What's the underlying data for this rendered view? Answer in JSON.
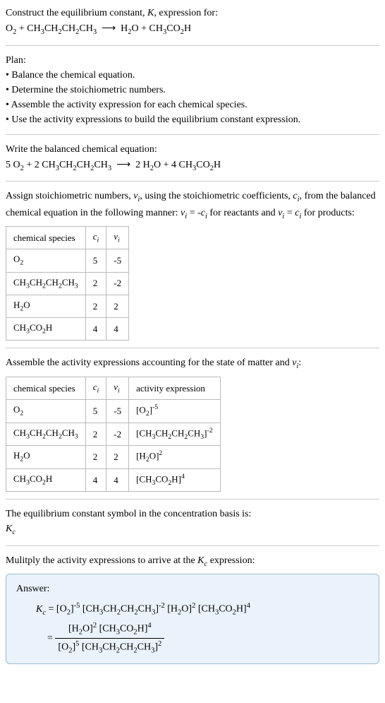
{
  "header": {
    "line1": "Construct the equilibrium constant, K, expression for:",
    "equation": "O₂ + CH₃CH₂CH₂CH₃  ⟶  H₂O + CH₃CO₂H"
  },
  "plan": {
    "title": "Plan:",
    "items": [
      "• Balance the chemical equation.",
      "• Determine the stoichiometric numbers.",
      "• Assemble the activity expression for each chemical species.",
      "• Use the activity expressions to build the equilibrium constant expression."
    ]
  },
  "balanced": {
    "title": "Write the balanced chemical equation:",
    "equation": "5 O₂ + 2 CH₃CH₂CH₂CH₃  ⟶  2 H₂O + 4 CH₃CO₂H"
  },
  "stoich": {
    "intro1": "Assign stoichiometric numbers, νᵢ, using the stoichiometric coefficients, cᵢ, from",
    "intro2": "the balanced chemical equation in the following manner: νᵢ = -cᵢ for reactants",
    "intro3": "and νᵢ = cᵢ for products:",
    "headers": [
      "chemical species",
      "cᵢ",
      "νᵢ"
    ],
    "rows": [
      {
        "species": "O₂",
        "c": "5",
        "v": "-5"
      },
      {
        "species": "CH₃CH₂CH₂CH₃",
        "c": "2",
        "v": "-2"
      },
      {
        "species": "H₂O",
        "c": "2",
        "v": "2"
      },
      {
        "species": "CH₃CO₂H",
        "c": "4",
        "v": "4"
      }
    ]
  },
  "activity": {
    "intro": "Assemble the activity expressions accounting for the state of matter and νᵢ:",
    "headers": [
      "chemical species",
      "cᵢ",
      "νᵢ",
      "activity expression"
    ],
    "rows": [
      {
        "species": "O₂",
        "c": "5",
        "v": "-5",
        "expr": "[O₂]⁻⁵"
      },
      {
        "species": "CH₃CH₂CH₂CH₃",
        "c": "2",
        "v": "-2",
        "expr": "[CH₃CH₂CH₂CH₃]⁻²"
      },
      {
        "species": "H₂O",
        "c": "2",
        "v": "2",
        "expr": "[H₂O]²"
      },
      {
        "species": "CH₃CO₂H",
        "c": "4",
        "v": "4",
        "expr": "[CH₃CO₂H]⁴"
      }
    ]
  },
  "kc_symbol": {
    "line1": "The equilibrium constant symbol in the concentration basis is:",
    "line2": "K_c"
  },
  "multiply": {
    "line": "Mulitply the activity expressions to arrive at the K_c expression:"
  },
  "answer": {
    "label": "Answer:",
    "top_line": "K_c = [O₂]⁻⁵ [CH₃CH₂CH₂CH₃]⁻² [H₂O]² [CH₃CO₂H]⁴",
    "frac_num": "[H₂O]² [CH₃CO₂H]⁴",
    "frac_den": "[O₂]⁵ [CH₃CH₂CH₂CH₃]²",
    "equals": " = "
  }
}
